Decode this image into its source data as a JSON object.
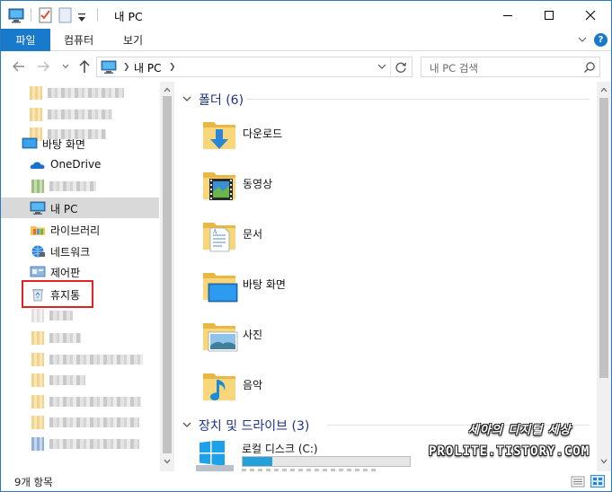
{
  "window": {
    "title": "내 PC"
  },
  "ribbon": {
    "tabs": [
      {
        "label": "파일"
      },
      {
        "label": "컴퓨터"
      },
      {
        "label": "보기"
      }
    ],
    "help_label": "?"
  },
  "navbar": {
    "address_text": "내 PC",
    "search_placeholder": "내 PC 검색"
  },
  "nav_pane": {
    "items": [
      {
        "label": "바탕 화면",
        "icon": "desktop-icon"
      },
      {
        "label": "OneDrive",
        "icon": "onedrive-cloud-icon"
      },
      {
        "label": "내 PC",
        "icon": "pc-icon",
        "selected": true
      },
      {
        "label": "라이브러리",
        "icon": "library-icon"
      },
      {
        "label": "네트워크",
        "icon": "network-icon"
      },
      {
        "label": "제어판",
        "icon": "control-panel-icon"
      },
      {
        "label": "휴지통",
        "icon": "recycle-bin-icon",
        "highlighted": true
      }
    ]
  },
  "content": {
    "folders_group": {
      "label": "폴더 (6)"
    },
    "folders": [
      {
        "label": "다운로드",
        "icon": "downloads-folder-icon"
      },
      {
        "label": "동영상",
        "icon": "videos-folder-icon"
      },
      {
        "label": "문서",
        "icon": "documents-folder-icon"
      },
      {
        "label": "바탕 화면",
        "icon": "desktop-folder-icon"
      },
      {
        "label": "사진",
        "icon": "pictures-folder-icon"
      },
      {
        "label": "음악",
        "icon": "music-folder-icon"
      }
    ],
    "drives_group": {
      "label": "장치 및 드라이브 (3)"
    },
    "drives": [
      {
        "label": "로컬 디스크 (C:)",
        "icon": "windows-drive-icon",
        "used_fraction": 0.18
      }
    ]
  },
  "watermark": {
    "line1": "세아의 디지털 세상",
    "line2": "PROLITE.TISTORY.COM"
  },
  "status": {
    "item_count": "9개 항목"
  },
  "colors": {
    "accent": "#1979ca",
    "highlight_box": "#e02323",
    "drive_fill": "#26a0da",
    "group_header": "#1e3287"
  }
}
